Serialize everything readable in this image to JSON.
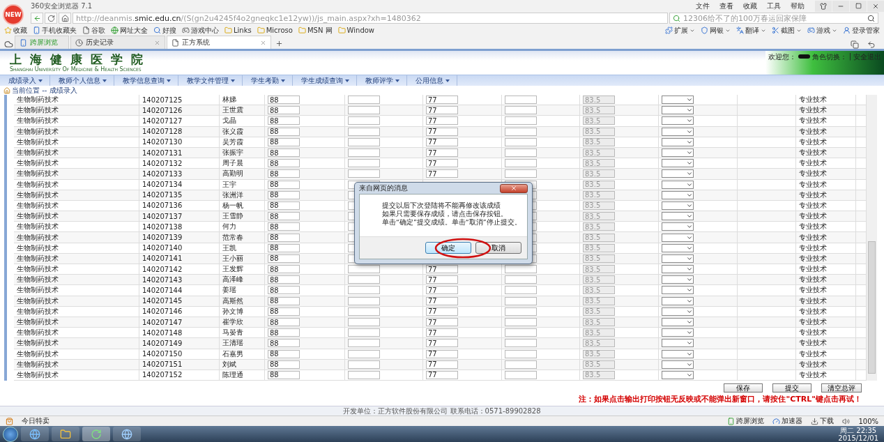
{
  "browser": {
    "badge": "NEW",
    "title": "360安全浏览器 7.1",
    "menu": [
      "文件",
      "查看",
      "收藏",
      "工具",
      "帮助"
    ],
    "url_prefix": "http://deanmis.",
    "url_host": "smic.edu.cn",
    "url_path": "/(S(gn2u4245f4o2gneqkc1e12yw))/js_main.aspx?xh=1480362",
    "search_placeholder": "12306给不了的100万春运回家保障",
    "bookmarks": [
      {
        "kind": "star",
        "label": "收藏"
      },
      {
        "kind": "phone",
        "label": "手机收藏夹"
      },
      {
        "kind": "page",
        "label": "谷歌"
      },
      {
        "kind": "globe",
        "label": "网址大全"
      },
      {
        "kind": "search",
        "label": "好搜"
      },
      {
        "kind": "game",
        "label": "游戏中心"
      },
      {
        "kind": "folder",
        "label": "Links"
      },
      {
        "kind": "folder",
        "label": "Microso"
      },
      {
        "kind": "folder",
        "label": "MSN 网"
      },
      {
        "kind": "folder",
        "label": "Window"
      }
    ],
    "tools": [
      "扩展",
      "网银",
      "翻译",
      "截图",
      "游戏"
    ],
    "login_manager": "登录管家",
    "tabs": [
      {
        "kind": "phone",
        "label": "跨屏浏览",
        "selected": false
      },
      {
        "kind": "history",
        "label": "历史记录",
        "selected": false
      },
      {
        "kind": "page",
        "label": "正方系统",
        "selected": true
      }
    ]
  },
  "page": {
    "school_name": "上海健康医学院",
    "school_name_en": "Shanghai University Of Medicine & Health Sciences",
    "welcome": "欢迎您：",
    "role_switch": "角色切换：",
    "separator": "|",
    "logout": "安全退出",
    "menus": [
      "成绩录入",
      "教师个人信息",
      "教学信息查询",
      "教学文件管理",
      "学生考勤",
      "学生成绩查询",
      "教师评学",
      "公用信息"
    ],
    "breadcrumb": "当前位置 -- 成绩录入",
    "rows": [
      {
        "major": "生物制药技术",
        "student_id": "140207125",
        "name": "林娣",
        "score_a": "88",
        "score_b": "77",
        "total": "83.5",
        "category": "专业技术"
      },
      {
        "major": "生物制药技术",
        "student_id": "140207126",
        "name": "王世震",
        "score_a": "88",
        "score_b": "77",
        "total": "83.5",
        "category": "专业技术"
      },
      {
        "major": "生物制药技术",
        "student_id": "140207127",
        "name": "戈晶",
        "score_a": "88",
        "score_b": "77",
        "total": "83.5",
        "category": "专业技术"
      },
      {
        "major": "生物制药技术",
        "student_id": "140207128",
        "name": "张义霞",
        "score_a": "88",
        "score_b": "77",
        "total": "83.5",
        "category": "专业技术"
      },
      {
        "major": "生物制药技术",
        "student_id": "140207130",
        "name": "吴芳霞",
        "score_a": "88",
        "score_b": "77",
        "total": "83.5",
        "category": "专业技术"
      },
      {
        "major": "生物制药技术",
        "student_id": "140207131",
        "name": "张振宇",
        "score_a": "88",
        "score_b": "77",
        "total": "83.5",
        "category": "专业技术"
      },
      {
        "major": "生物制药技术",
        "student_id": "140207132",
        "name": "周子晨",
        "score_a": "88",
        "score_b": "77",
        "total": "83.5",
        "category": "专业技术"
      },
      {
        "major": "生物制药技术",
        "student_id": "140207133",
        "name": "高勤明",
        "score_a": "88",
        "score_b": "77",
        "total": "83.5",
        "category": "专业技术"
      },
      {
        "major": "生物制药技术",
        "student_id": "140207134",
        "name": "王宇",
        "score_a": "88",
        "total": "83.5",
        "category": "专业技术"
      },
      {
        "major": "生物制药技术",
        "student_id": "140207135",
        "name": "张洲洋",
        "score_a": "88",
        "total": "83.5",
        "category": "专业技术"
      },
      {
        "major": "生物制药技术",
        "student_id": "140207136",
        "name": "杨一帆",
        "score_a": "88",
        "total": "83.5",
        "category": "专业技术"
      },
      {
        "major": "生物制药技术",
        "student_id": "140207137",
        "name": "王雪静",
        "score_a": "88",
        "total": "83.5",
        "category": "专业技术"
      },
      {
        "major": "生物制药技术",
        "student_id": "140207138",
        "name": "何力",
        "score_a": "88",
        "total": "83.5",
        "category": "专业技术"
      },
      {
        "major": "生物制药技术",
        "student_id": "140207139",
        "name": "范常春",
        "score_a": "88",
        "total": "83.5",
        "category": "专业技术"
      },
      {
        "major": "生物制药技术",
        "student_id": "140207140",
        "name": "王凯",
        "score_a": "88",
        "total": "83.5",
        "category": "专业技术"
      },
      {
        "major": "生物制药技术",
        "student_id": "140207141",
        "name": "王小丽",
        "score_a": "88",
        "total": "83.5",
        "category": "专业技术"
      },
      {
        "major": "生物制药技术",
        "student_id": "140207142",
        "name": "王发辉",
        "score_a": "88",
        "score_b": "77",
        "total": "83.5",
        "category": "专业技术"
      },
      {
        "major": "生物制药技术",
        "student_id": "140207143",
        "name": "高泽峰",
        "score_a": "88",
        "score_b": "77",
        "total": "83.5",
        "category": "专业技术"
      },
      {
        "major": "生物制药技术",
        "student_id": "140207144",
        "name": "姜瑶",
        "score_a": "88",
        "score_b": "77",
        "total": "83.5",
        "category": "专业技术"
      },
      {
        "major": "生物制药技术",
        "student_id": "140207145",
        "name": "高斯然",
        "score_a": "88",
        "score_b": "77",
        "total": "83.5",
        "category": "专业技术"
      },
      {
        "major": "生物制药技术",
        "student_id": "140207146",
        "name": "孙文博",
        "score_a": "88",
        "score_b": "77",
        "total": "83.5",
        "category": "专业技术"
      },
      {
        "major": "生物制药技术",
        "student_id": "140207147",
        "name": "崔学欣",
        "score_a": "88",
        "score_b": "77",
        "total": "83.5",
        "category": "专业技术"
      },
      {
        "major": "生物制药技术",
        "student_id": "140207148",
        "name": "马晏青",
        "score_a": "88",
        "score_b": "77",
        "total": "83.5",
        "category": "专业技术"
      },
      {
        "major": "生物制药技术",
        "student_id": "140207149",
        "name": "王清瑶",
        "score_a": "88",
        "score_b": "77",
        "total": "83.5",
        "category": "专业技术"
      },
      {
        "major": "生物制药技术",
        "student_id": "140207150",
        "name": "石嘉男",
        "score_a": "88",
        "score_b": "77",
        "total": "83.5",
        "category": "专业技术"
      },
      {
        "major": "生物制药技术",
        "student_id": "140207151",
        "name": "刘斌",
        "score_a": "88",
        "score_b": "77",
        "total": "83.5",
        "category": "专业技术"
      },
      {
        "major": "生物制药技术",
        "student_id": "140207152",
        "name": "陈理通",
        "score_a": "88",
        "score_b": "77",
        "total": "83.5",
        "category": "专业技术"
      }
    ],
    "actions": [
      "保存",
      "提交",
      "清空总评"
    ],
    "note": "注：如果点击输出打印按钮无反映或不能弹出新窗口，请按住\"CTRL\"键点击再试！",
    "footer": "开发单位：正方软件股份有限公司 联系电话：0571-89902828"
  },
  "dialog": {
    "title": "来自网页的消息",
    "lines": [
      "提交以后下次登陆将不能再修改该成绩",
      "如果只需要保存成绩，请点击保存按钮。",
      "单击“确定”提交成绩。单击“取消”停止提交。"
    ],
    "buttons": [
      {
        "label": "确定",
        "highlighted": true
      },
      {
        "label": "取消",
        "highlighted": false
      }
    ]
  },
  "status_bar": {
    "left": "今日特卖",
    "items": [
      "跨屏浏览",
      "加速器",
      "下载"
    ],
    "zoom": "100%"
  },
  "taskbar": {
    "day_time": "周二 22:35",
    "date": "2015/12/01"
  }
}
